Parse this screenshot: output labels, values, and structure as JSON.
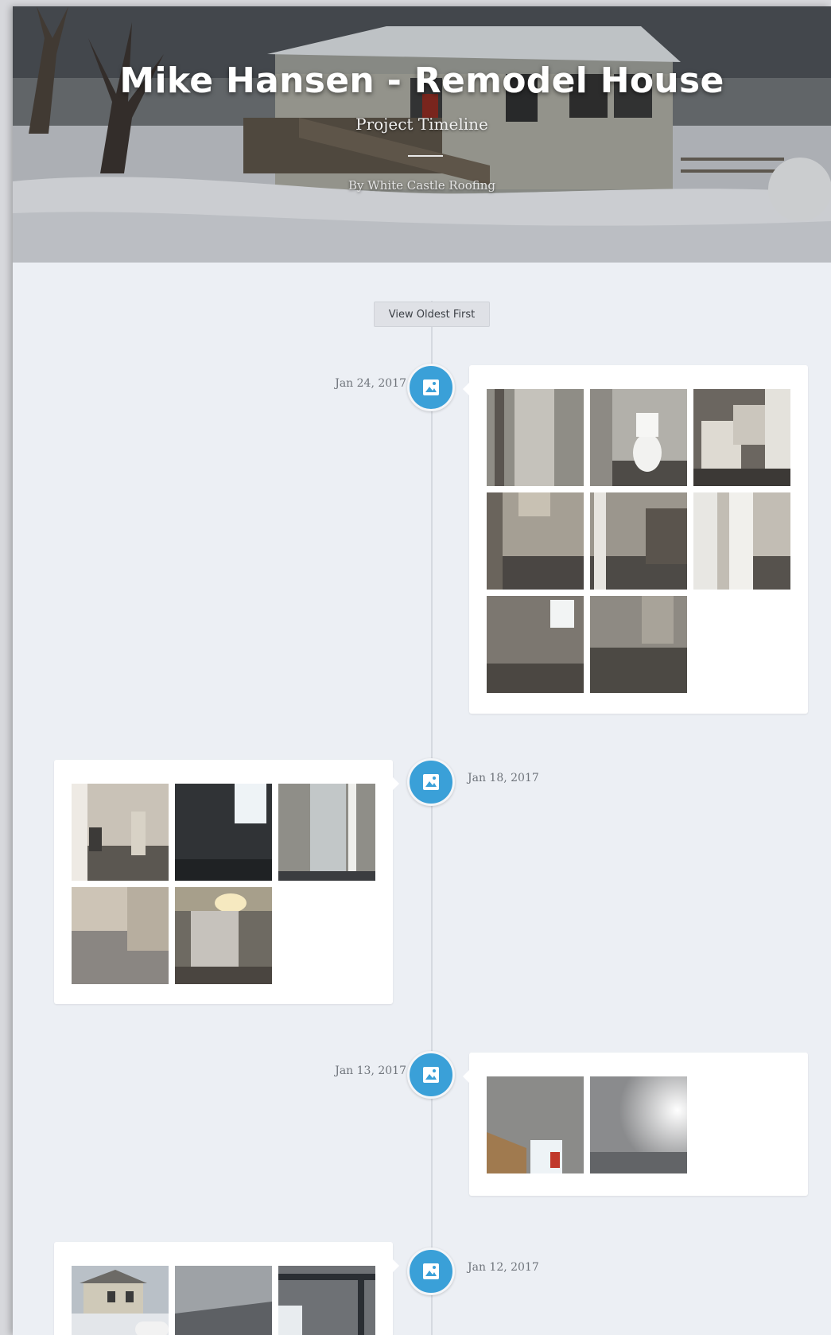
{
  "hero": {
    "title": "Mike Hansen - Remodel House",
    "subtitle": "Project Timeline",
    "byline": "By White Castle Roofing"
  },
  "timeline": {
    "sort_button": "View Oldest First",
    "entries": [
      {
        "date": "Jan 24, 2017",
        "icon": "image-icon",
        "photos": [
          "hallway-door-photo",
          "toilet-photo",
          "water-heater-photo",
          "empty-room-photo",
          "closet-photo",
          "open-door-photo",
          "window-corner-photo",
          "room-shelf-photo"
        ]
      },
      {
        "date": "Jan 18, 2017",
        "icon": "image-icon",
        "photos": [
          "ladder-room-photo",
          "dark-room-window-photo",
          "door-photo",
          "bare-corner-photo",
          "ceiling-light-photo"
        ]
      },
      {
        "date": "Jan 13, 2017",
        "icon": "image-icon",
        "photos": [
          "window-ceiling-photo",
          "bright-ceiling-photo"
        ]
      },
      {
        "date": "Jan 12, 2017",
        "icon": "image-icon",
        "photos": [
          "house-exterior-photo",
          "ceiling-photo",
          "wall-beam-photo"
        ]
      }
    ]
  },
  "colors": {
    "accent": "#3aa0d8",
    "background": "#eceff4",
    "card": "#ffffff"
  }
}
